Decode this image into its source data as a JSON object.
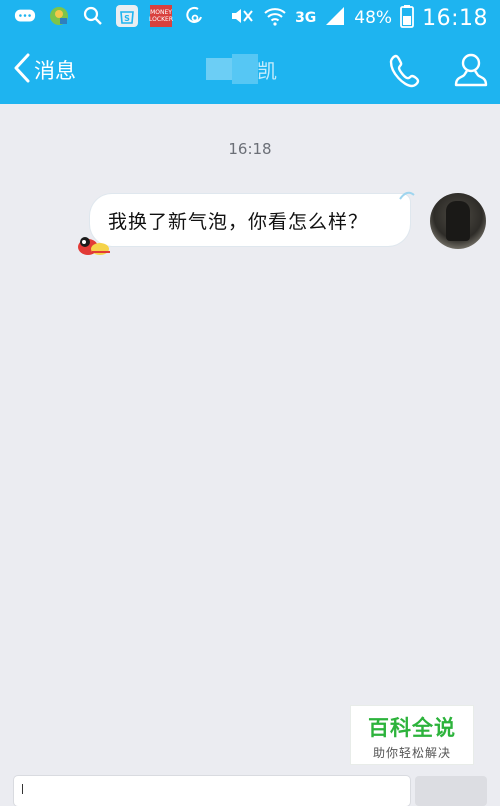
{
  "statusbar": {
    "left_icons": [
      "message-icon",
      "qq-icon",
      "search-icon",
      "store-icon",
      "money-locker-icon",
      "sync-icon"
    ],
    "money_locker_label": "MONEY LOCKER",
    "network": "3G",
    "battery": "48%",
    "time": "16:18"
  },
  "header": {
    "back_label": "消息",
    "title": "凯",
    "accent_color": "#1eb4f0",
    "icons": [
      "phone-icon",
      "profile-icon"
    ]
  },
  "chat": {
    "timestamp": "16:18",
    "messages": [
      {
        "sender": "self",
        "text": "我换了新气泡，你看怎么样？"
      }
    ]
  },
  "watermark": {
    "main": "百科全说",
    "sub": "助你轻松解决"
  }
}
